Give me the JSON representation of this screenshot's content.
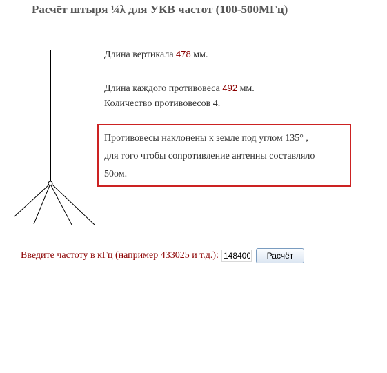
{
  "title": "Расчёт штыря ¼λ для УКВ частот (100-500МГц)",
  "results": {
    "vertical_prefix": "Длина вертикала ",
    "vertical_value": "478",
    "vertical_suffix": " мм.",
    "counterpoise_prefix": "Длина каждого противовеса ",
    "counterpoise_value": "492",
    "counterpoise_suffix": " мм.",
    "counterpoise_count": "Количество противовесов 4."
  },
  "note": {
    "line1": "Противовесы наклонены к земле под углом 135° ,",
    "line2": "для того чтобы сопротивление антенны составляло",
    "line3": "50ом."
  },
  "form": {
    "label": "Введите частоту в кГц (например 433025 и т.д.):",
    "frequency_value": "148400",
    "button_label": "Расчёт"
  },
  "colors": {
    "value_color": "#8b0000",
    "note_border": "#cc2222",
    "label_color": "#8b0000"
  }
}
